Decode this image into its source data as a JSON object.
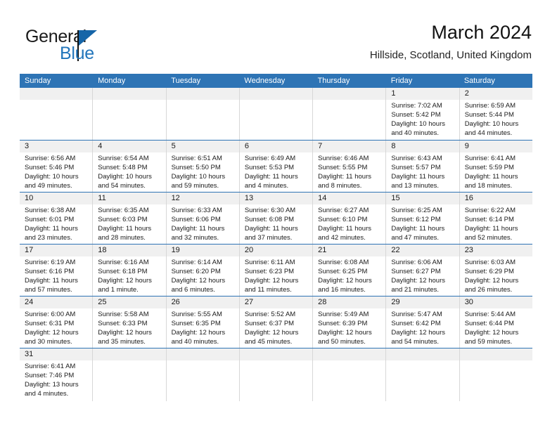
{
  "brand": {
    "name_part1": "General",
    "name_part2": "Blue",
    "logo_icon": "triangle-flag-icon"
  },
  "header": {
    "title": "March 2024",
    "subtitle": "Hillside, Scotland, United Kingdom"
  },
  "colors": {
    "header_blue": "#2e74b5",
    "date_band": "#f0f0f0",
    "brand_blue": "#2275bb",
    "text": "#1a1a1a"
  },
  "weekdays": [
    "Sunday",
    "Monday",
    "Tuesday",
    "Wednesday",
    "Thursday",
    "Friday",
    "Saturday"
  ],
  "weeks": [
    [
      {
        "empty": true
      },
      {
        "empty": true
      },
      {
        "empty": true
      },
      {
        "empty": true
      },
      {
        "empty": true
      },
      {
        "date": "1",
        "sunrise": "Sunrise: 7:02 AM",
        "sunset": "Sunset: 5:42 PM",
        "daylight1": "Daylight: 10 hours",
        "daylight2": "and 40 minutes."
      },
      {
        "date": "2",
        "sunrise": "Sunrise: 6:59 AM",
        "sunset": "Sunset: 5:44 PM",
        "daylight1": "Daylight: 10 hours",
        "daylight2": "and 44 minutes."
      }
    ],
    [
      {
        "date": "3",
        "sunrise": "Sunrise: 6:56 AM",
        "sunset": "Sunset: 5:46 PM",
        "daylight1": "Daylight: 10 hours",
        "daylight2": "and 49 minutes."
      },
      {
        "date": "4",
        "sunrise": "Sunrise: 6:54 AM",
        "sunset": "Sunset: 5:48 PM",
        "daylight1": "Daylight: 10 hours",
        "daylight2": "and 54 minutes."
      },
      {
        "date": "5",
        "sunrise": "Sunrise: 6:51 AM",
        "sunset": "Sunset: 5:50 PM",
        "daylight1": "Daylight: 10 hours",
        "daylight2": "and 59 minutes."
      },
      {
        "date": "6",
        "sunrise": "Sunrise: 6:49 AM",
        "sunset": "Sunset: 5:53 PM",
        "daylight1": "Daylight: 11 hours",
        "daylight2": "and 4 minutes."
      },
      {
        "date": "7",
        "sunrise": "Sunrise: 6:46 AM",
        "sunset": "Sunset: 5:55 PM",
        "daylight1": "Daylight: 11 hours",
        "daylight2": "and 8 minutes."
      },
      {
        "date": "8",
        "sunrise": "Sunrise: 6:43 AM",
        "sunset": "Sunset: 5:57 PM",
        "daylight1": "Daylight: 11 hours",
        "daylight2": "and 13 minutes."
      },
      {
        "date": "9",
        "sunrise": "Sunrise: 6:41 AM",
        "sunset": "Sunset: 5:59 PM",
        "daylight1": "Daylight: 11 hours",
        "daylight2": "and 18 minutes."
      }
    ],
    [
      {
        "date": "10",
        "sunrise": "Sunrise: 6:38 AM",
        "sunset": "Sunset: 6:01 PM",
        "daylight1": "Daylight: 11 hours",
        "daylight2": "and 23 minutes."
      },
      {
        "date": "11",
        "sunrise": "Sunrise: 6:35 AM",
        "sunset": "Sunset: 6:03 PM",
        "daylight1": "Daylight: 11 hours",
        "daylight2": "and 28 minutes."
      },
      {
        "date": "12",
        "sunrise": "Sunrise: 6:33 AM",
        "sunset": "Sunset: 6:06 PM",
        "daylight1": "Daylight: 11 hours",
        "daylight2": "and 32 minutes."
      },
      {
        "date": "13",
        "sunrise": "Sunrise: 6:30 AM",
        "sunset": "Sunset: 6:08 PM",
        "daylight1": "Daylight: 11 hours",
        "daylight2": "and 37 minutes."
      },
      {
        "date": "14",
        "sunrise": "Sunrise: 6:27 AM",
        "sunset": "Sunset: 6:10 PM",
        "daylight1": "Daylight: 11 hours",
        "daylight2": "and 42 minutes."
      },
      {
        "date": "15",
        "sunrise": "Sunrise: 6:25 AM",
        "sunset": "Sunset: 6:12 PM",
        "daylight1": "Daylight: 11 hours",
        "daylight2": "and 47 minutes."
      },
      {
        "date": "16",
        "sunrise": "Sunrise: 6:22 AM",
        "sunset": "Sunset: 6:14 PM",
        "daylight1": "Daylight: 11 hours",
        "daylight2": "and 52 minutes."
      }
    ],
    [
      {
        "date": "17",
        "sunrise": "Sunrise: 6:19 AM",
        "sunset": "Sunset: 6:16 PM",
        "daylight1": "Daylight: 11 hours",
        "daylight2": "and 57 minutes."
      },
      {
        "date": "18",
        "sunrise": "Sunrise: 6:16 AM",
        "sunset": "Sunset: 6:18 PM",
        "daylight1": "Daylight: 12 hours",
        "daylight2": "and 1 minute."
      },
      {
        "date": "19",
        "sunrise": "Sunrise: 6:14 AM",
        "sunset": "Sunset: 6:20 PM",
        "daylight1": "Daylight: 12 hours",
        "daylight2": "and 6 minutes."
      },
      {
        "date": "20",
        "sunrise": "Sunrise: 6:11 AM",
        "sunset": "Sunset: 6:23 PM",
        "daylight1": "Daylight: 12 hours",
        "daylight2": "and 11 minutes."
      },
      {
        "date": "21",
        "sunrise": "Sunrise: 6:08 AM",
        "sunset": "Sunset: 6:25 PM",
        "daylight1": "Daylight: 12 hours",
        "daylight2": "and 16 minutes."
      },
      {
        "date": "22",
        "sunrise": "Sunrise: 6:06 AM",
        "sunset": "Sunset: 6:27 PM",
        "daylight1": "Daylight: 12 hours",
        "daylight2": "and 21 minutes."
      },
      {
        "date": "23",
        "sunrise": "Sunrise: 6:03 AM",
        "sunset": "Sunset: 6:29 PM",
        "daylight1": "Daylight: 12 hours",
        "daylight2": "and 26 minutes."
      }
    ],
    [
      {
        "date": "24",
        "sunrise": "Sunrise: 6:00 AM",
        "sunset": "Sunset: 6:31 PM",
        "daylight1": "Daylight: 12 hours",
        "daylight2": "and 30 minutes."
      },
      {
        "date": "25",
        "sunrise": "Sunrise: 5:58 AM",
        "sunset": "Sunset: 6:33 PM",
        "daylight1": "Daylight: 12 hours",
        "daylight2": "and 35 minutes."
      },
      {
        "date": "26",
        "sunrise": "Sunrise: 5:55 AM",
        "sunset": "Sunset: 6:35 PM",
        "daylight1": "Daylight: 12 hours",
        "daylight2": "and 40 minutes."
      },
      {
        "date": "27",
        "sunrise": "Sunrise: 5:52 AM",
        "sunset": "Sunset: 6:37 PM",
        "daylight1": "Daylight: 12 hours",
        "daylight2": "and 45 minutes."
      },
      {
        "date": "28",
        "sunrise": "Sunrise: 5:49 AM",
        "sunset": "Sunset: 6:39 PM",
        "daylight1": "Daylight: 12 hours",
        "daylight2": "and 50 minutes."
      },
      {
        "date": "29",
        "sunrise": "Sunrise: 5:47 AM",
        "sunset": "Sunset: 6:42 PM",
        "daylight1": "Daylight: 12 hours",
        "daylight2": "and 54 minutes."
      },
      {
        "date": "30",
        "sunrise": "Sunrise: 5:44 AM",
        "sunset": "Sunset: 6:44 PM",
        "daylight1": "Daylight: 12 hours",
        "daylight2": "and 59 minutes."
      }
    ],
    [
      {
        "date": "31",
        "sunrise": "Sunrise: 6:41 AM",
        "sunset": "Sunset: 7:46 PM",
        "daylight1": "Daylight: 13 hours",
        "daylight2": "and 4 minutes."
      },
      {
        "empty": true
      },
      {
        "empty": true
      },
      {
        "empty": true
      },
      {
        "empty": true
      },
      {
        "empty": true
      },
      {
        "empty": true
      }
    ]
  ]
}
